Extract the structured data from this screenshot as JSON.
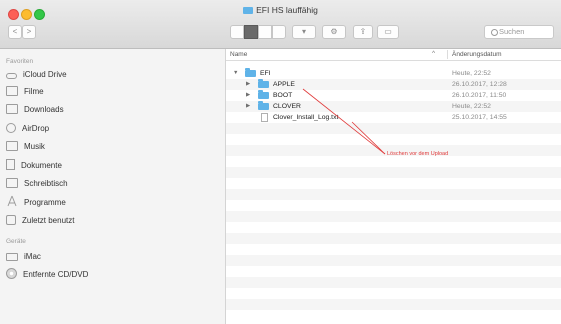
{
  "window": {
    "title": "EFI HS lauffähig"
  },
  "toolbar": {
    "back_label": "<",
    "forward_label": ">",
    "search_placeholder": "Suchen"
  },
  "sidebar": {
    "favorites_header": "Favoriten",
    "favorites": [
      {
        "label": "iCloud Drive",
        "icon": "cloud-icon"
      },
      {
        "label": "Filme",
        "icon": "folder-icon"
      },
      {
        "label": "Downloads",
        "icon": "downloads-folder-icon"
      },
      {
        "label": "AirDrop",
        "icon": "airdrop-icon"
      },
      {
        "label": "Musik",
        "icon": "music-folder-icon"
      },
      {
        "label": "Dokumente",
        "icon": "document-icon"
      },
      {
        "label": "Schreibtisch",
        "icon": "desktop-folder-icon"
      },
      {
        "label": "Programme",
        "icon": "applications-icon"
      },
      {
        "label": "Zuletzt benutzt",
        "icon": "recents-icon"
      }
    ],
    "devices_header": "Geräte",
    "devices": [
      {
        "label": "iMac",
        "icon": "imac-icon"
      },
      {
        "label": "Entfernte CD/DVD",
        "icon": "disc-icon"
      }
    ]
  },
  "filelist": {
    "col_name": "Name",
    "col_date": "Änderungsdatum",
    "rows": [
      {
        "name": "EFI",
        "date": "Heute, 22:52"
      },
      {
        "name": "APPLE",
        "date": "26.10.2017, 12:28"
      },
      {
        "name": "BOOT",
        "date": "26.10.2017, 11:50"
      },
      {
        "name": "CLOVER",
        "date": "Heute, 22:52"
      },
      {
        "name": "Clover_Install_Log.txt",
        "date": "25.10.2017, 14:55"
      }
    ]
  },
  "annotation": {
    "text": "Löschen vor dem Upload",
    "color": "#e03a3a"
  },
  "colors": {
    "folder": "#5fb3e8",
    "accent_selected": "#6a6a6a"
  }
}
